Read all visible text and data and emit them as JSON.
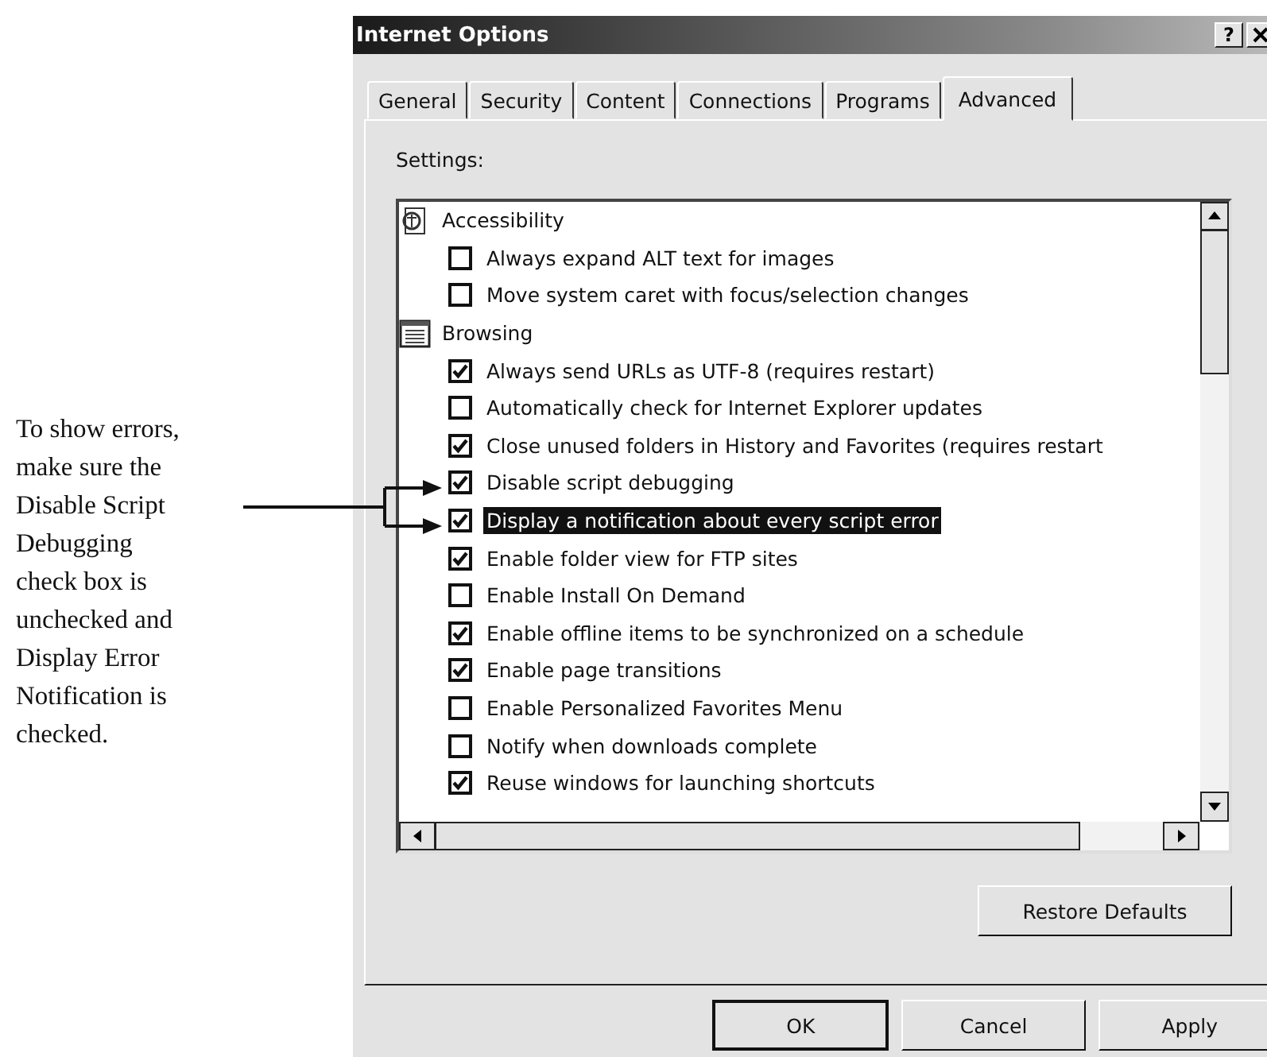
{
  "annotation": {
    "lines": [
      "To show errors,",
      "make sure the",
      "Disable Script",
      "Debugging",
      "check box is",
      "unchecked and",
      "Display Error",
      "Notification  is",
      "checked."
    ]
  },
  "window": {
    "title": "Internet Options",
    "help_button": "?"
  },
  "tabs": [
    {
      "label": "General",
      "selected": false
    },
    {
      "label": "Security",
      "selected": false
    },
    {
      "label": "Content",
      "selected": false
    },
    {
      "label": "Connections",
      "selected": false
    },
    {
      "label": "Programs",
      "selected": false
    },
    {
      "label": "Advanced",
      "selected": true
    }
  ],
  "settings_label": "Settings:",
  "tree": [
    {
      "label": "Accessibility",
      "kind": "accessibility",
      "children": [
        {
          "label": "Always expand ALT text for images",
          "checked": false,
          "selected": false
        },
        {
          "label": "Move system caret with focus/selection changes",
          "checked": false,
          "selected": false
        }
      ]
    },
    {
      "label": "Browsing",
      "kind": "browsing",
      "children": [
        {
          "label": "Always send URLs as UTF-8 (requires restart)",
          "checked": true,
          "selected": false
        },
        {
          "label": "Automatically check for Internet Explorer updates",
          "checked": false,
          "selected": false
        },
        {
          "label": "Close unused folders in History and Favorites (requires restart",
          "checked": true,
          "selected": false
        },
        {
          "label": "Disable script debugging",
          "checked": true,
          "selected": false
        },
        {
          "label": "Display a notification about every script error",
          "checked": true,
          "selected": true
        },
        {
          "label": "Enable folder view for FTP sites",
          "checked": true,
          "selected": false
        },
        {
          "label": "Enable Install On Demand",
          "checked": false,
          "selected": false
        },
        {
          "label": "Enable offline items to be synchronized on a schedule",
          "checked": true,
          "selected": false
        },
        {
          "label": "Enable page transitions",
          "checked": true,
          "selected": false
        },
        {
          "label": "Enable Personalized Favorites Menu",
          "checked": false,
          "selected": false
        },
        {
          "label": "Notify when downloads complete",
          "checked": false,
          "selected": false
        },
        {
          "label": "Reuse windows for launching shortcuts",
          "checked": true,
          "selected": false
        }
      ]
    }
  ],
  "restore_button": "Restore Defaults",
  "buttons": [
    "OK",
    "Cancel",
    "Apply"
  ]
}
